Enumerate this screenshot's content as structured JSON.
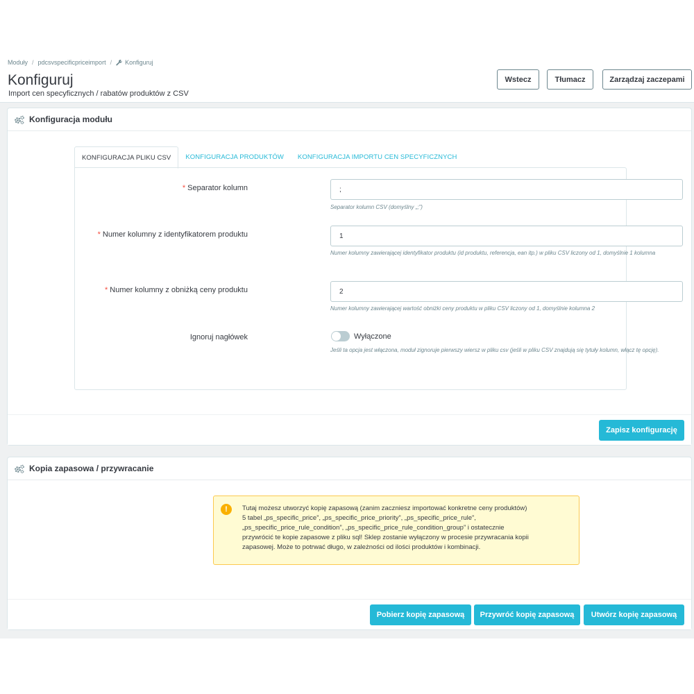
{
  "breadcrumb": {
    "items": [
      "Moduły",
      "pdcsvspecificpriceimport"
    ],
    "current": "Konfiguruj"
  },
  "header": {
    "title": "Konfiguruj",
    "subtitle": "Import cen specyficznych / rabatów produktów z CSV",
    "buttons": {
      "back": "Wstecz",
      "translate": "Tłumacz",
      "hooks": "Zarządzaj zaczepami"
    }
  },
  "config_panel": {
    "title": "Konfiguracja modułu",
    "tabs": [
      "KONFIGURACJA PLIKU CSV",
      "KONFIGURACJA PRODUKTÓW",
      "KONFIGURACJA IMPORTU CEN SPECYFICZNYCH"
    ],
    "active_tab": 0,
    "fields": {
      "separator": {
        "required": "*",
        "label": "Separator kolumn",
        "value": ";",
        "help": "Separator kolumn CSV (domyślny „;”)"
      },
      "id_column": {
        "required": "*",
        "label": "Numer kolumny z identyfikatorem produktu",
        "value": "1",
        "help": "Numer kolumny zawierającej identyfikator produktu (id produktu, referencja, ean itp.) w pliku CSV liczony od 1, domyślnie 1 kolumna"
      },
      "discount_column": {
        "required": "*",
        "label": "Numer kolumny z obniżką ceny produktu",
        "value": "2",
        "help": "Numer kolumny zawierającej wartość obniżki ceny produktu w pliku CSV liczony od 1, domyślnie kolumna 2"
      },
      "ignore_header": {
        "label": "Ignoruj nagłówek",
        "state": "Wyłączone",
        "enabled": false,
        "help": "Jeśli ta opcja jest włączona, moduł zignoruje pierwszy wiersz w pliku csv (jeśli w pliku CSV znajdują się tytuły kolumn, włącz tę opcję)."
      }
    },
    "save_label": "Zapisz konfigurację"
  },
  "backup_panel": {
    "title": "Kopia zapasowa / przywracanie",
    "alert_lines": [
      "Tutaj możesz utworzyć kopię zapasową (zanim zaczniesz importować konkretne ceny produktów)",
      "5 tabel „ps_specific_price”, „ps_specific_price_priority”, „ps_specific_price_rule”,",
      "„ps_specific_price_rule_condition”, „ps_specific_price_rule_condition_group” i ostatecznie",
      "przywrócić te kopie zapasowe z pliku sql! Sklep zostanie wyłączony w procesie przywracania kopii",
      "zapasowej. Może to potrwać długo, w zależności od ilości produktów i kombinacji."
    ],
    "alert_icon": "!",
    "buttons": {
      "download": "Pobierz kopię zapasową",
      "restore": "Przywróć kopię zapasową",
      "create": "Utwórz kopię zapasową"
    }
  },
  "colors": {
    "primary": "#25b9d7",
    "warning": "#fab000",
    "required": "#f54c3e"
  }
}
